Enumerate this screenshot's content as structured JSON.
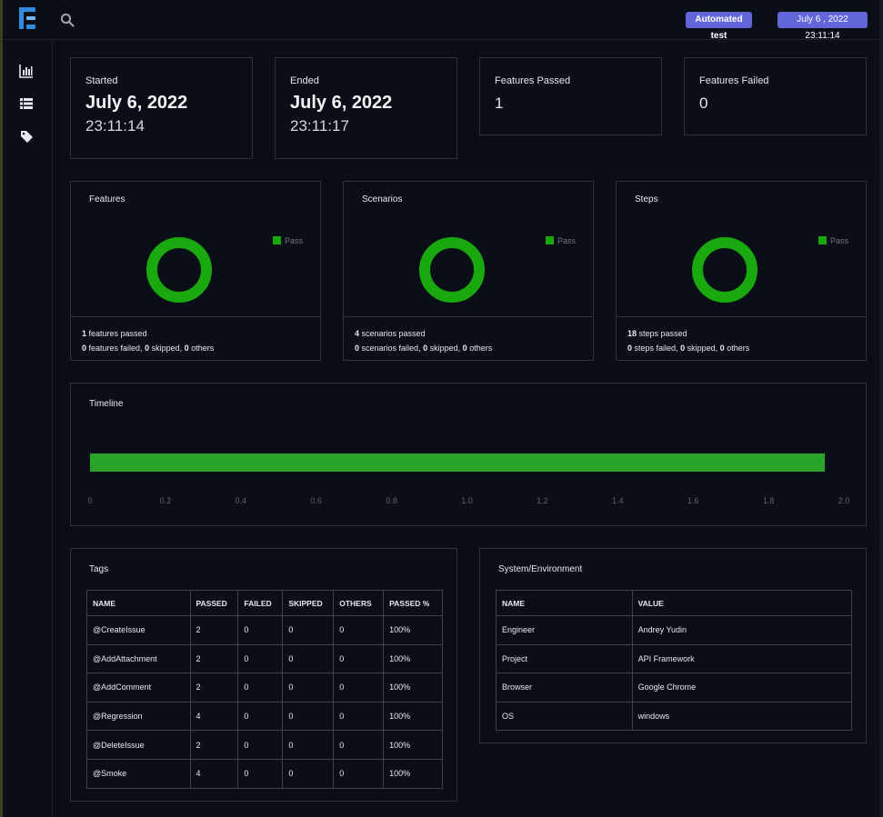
{
  "header": {
    "badge_label": "Automated test",
    "date_badge": "July 6 , 2022 23:11:14"
  },
  "sidebar": {
    "items": [
      {
        "icon": "bar-chart-icon"
      },
      {
        "icon": "list-icon"
      },
      {
        "icon": "tag-icon"
      }
    ]
  },
  "summary": {
    "started": {
      "label": "Started",
      "date": "July 6, 2022",
      "time": "23:11:14"
    },
    "ended": {
      "label": "Ended",
      "date": "July 6, 2022",
      "time": "23:11:17"
    },
    "features_passed": {
      "label": "Features Passed",
      "value": "1"
    },
    "features_failed": {
      "label": "Features Failed",
      "value": "0"
    }
  },
  "charts": {
    "features": {
      "title": "Features",
      "legend": "Pass",
      "passed_num": "1",
      "passed_text": "features passed",
      "failed_num": "0",
      "failed_text": "features failed,",
      "skipped_num": "0",
      "skipped_text": "skipped,",
      "others_num": "0",
      "others_text": "others"
    },
    "scenarios": {
      "title": "Scenarios",
      "legend": "Pass",
      "passed_num": "4",
      "passed_text": "scenarios passed",
      "failed_num": "0",
      "failed_text": "scenarios failed,",
      "skipped_num": "0",
      "skipped_text": "skipped,",
      "others_num": "0",
      "others_text": "others"
    },
    "steps": {
      "title": "Steps",
      "legend": "Pass",
      "passed_num": "18",
      "passed_text": "steps passed",
      "failed_num": "0",
      "failed_text": "steps failed,",
      "skipped_num": "0",
      "skipped_text": "skipped,",
      "others_num": "0",
      "others_text": "others"
    }
  },
  "timeline": {
    "title": "Timeline",
    "ticks": [
      "0",
      "0.2",
      "0.4",
      "0.6",
      "0.8",
      "1.0",
      "1.2",
      "1.4",
      "1.6",
      "1.8",
      "2.0"
    ],
    "bar_start": 0,
    "bar_end": 1.95,
    "bar_color": "#29a329"
  },
  "tags": {
    "title": "Tags",
    "headers": [
      "NAME",
      "PASSED",
      "FAILED",
      "SKIPPED",
      "OTHERS",
      "PASSED %"
    ],
    "rows": [
      [
        "@CreateIssue",
        "2",
        "0",
        "0",
        "0",
        "100%"
      ],
      [
        "@AddAttachment",
        "2",
        "0",
        "0",
        "0",
        "100%"
      ],
      [
        "@AddComment",
        "2",
        "0",
        "0",
        "0",
        "100%"
      ],
      [
        "@Regression",
        "4",
        "0",
        "0",
        "0",
        "100%"
      ],
      [
        "@DeleteIssue",
        "2",
        "0",
        "0",
        "0",
        "100%"
      ],
      [
        "@Smoke",
        "4",
        "0",
        "0",
        "0",
        "100%"
      ]
    ]
  },
  "environment": {
    "title": "System/Environment",
    "headers": [
      "NAME",
      "VALUE"
    ],
    "rows": [
      [
        "Engineer",
        "Andrey Yudin"
      ],
      [
        "Project",
        "API Framework"
      ],
      [
        "Browser",
        "Google Chrome"
      ],
      [
        "OS",
        "windows"
      ]
    ]
  },
  "colors": {
    "pass": "#19a90f",
    "badge": "#6266d8",
    "background": "#0a0f17"
  }
}
